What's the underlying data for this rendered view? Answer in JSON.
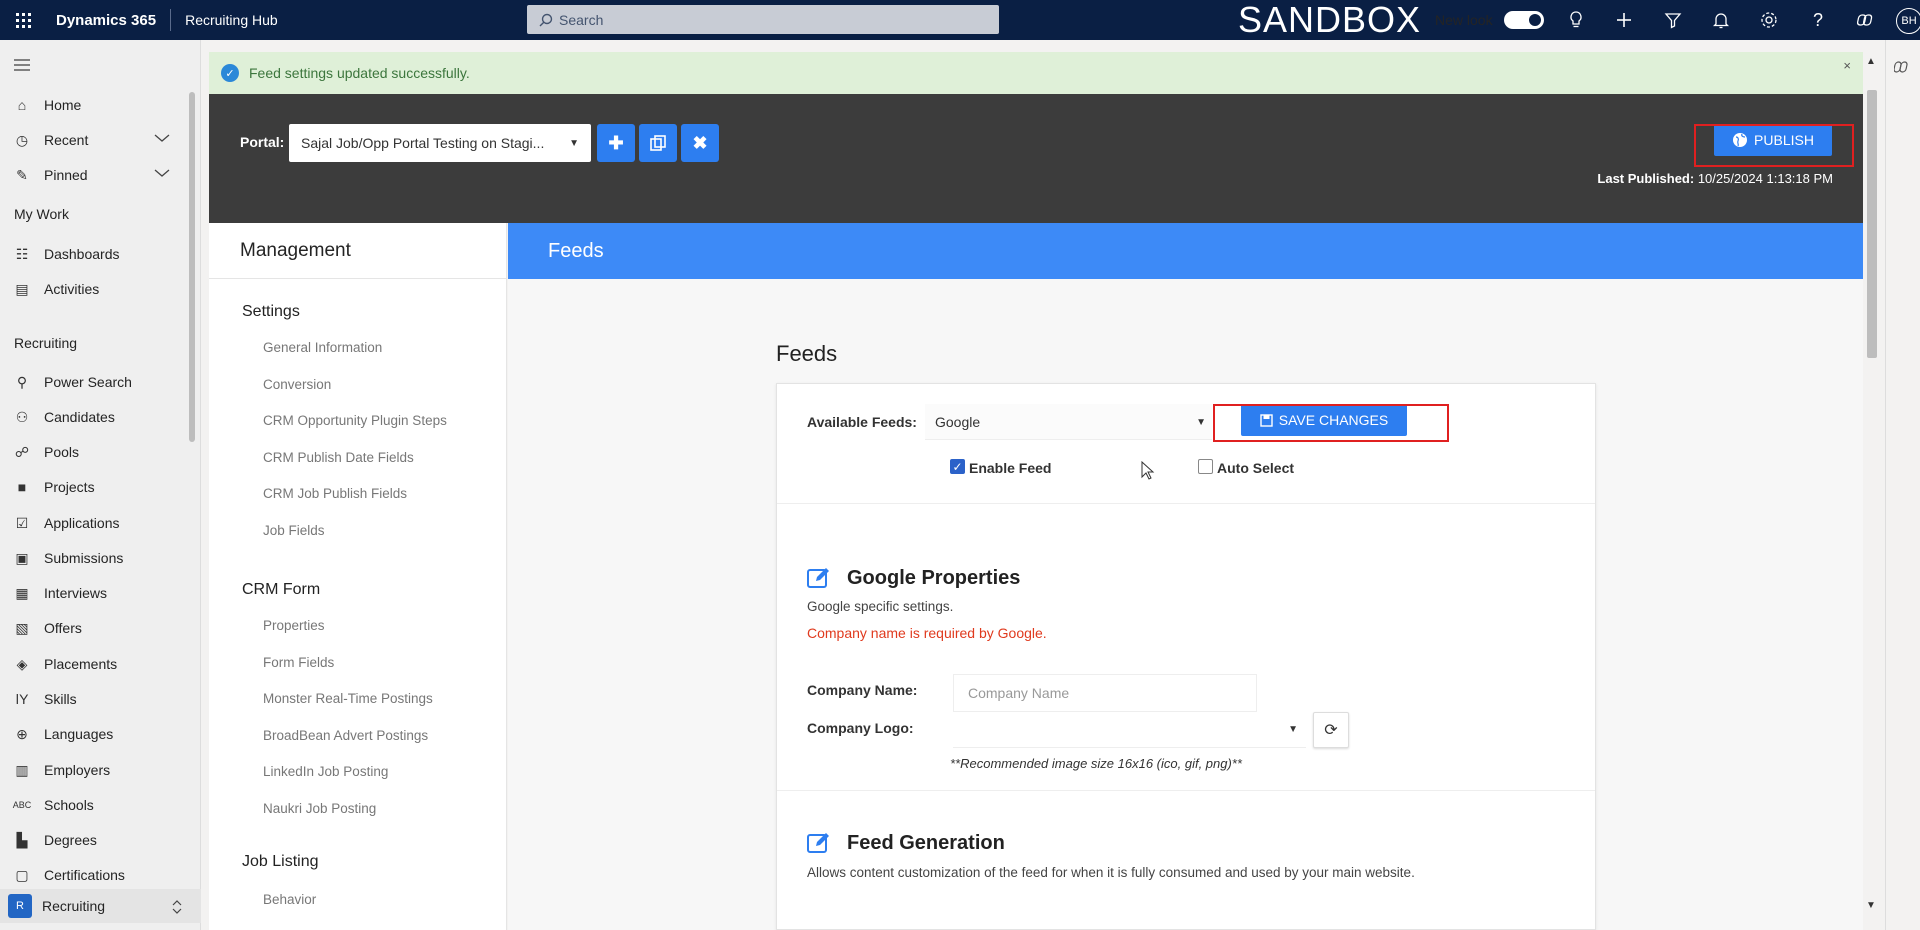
{
  "topbar": {
    "app_name": "Dynamics 365",
    "area_name": "Recruiting Hub",
    "search_placeholder": "Search",
    "environment": "SANDBOX",
    "new_look_label": "New look",
    "new_look_on": true,
    "avatar_initials": "BH",
    "icons": [
      "lightbulb-icon",
      "plus-icon",
      "filter-icon",
      "bell-icon",
      "gear-icon",
      "help-icon",
      "copilot-icon"
    ]
  },
  "nav": {
    "home": "Home",
    "recent": "Recent",
    "pinned": "Pinned",
    "my_work": "My Work",
    "dashboards": "Dashboards",
    "activities": "Activities",
    "recruiting_group": "Recruiting",
    "items": [
      "Power Search",
      "Candidates",
      "Pools",
      "Projects",
      "Applications",
      "Submissions",
      "Interviews",
      "Offers",
      "Placements",
      "Skills",
      "Languages",
      "Employers",
      "Schools",
      "Degrees",
      "Certifications"
    ],
    "area_badge": "R",
    "area_switch": "Recruiting"
  },
  "alert": {
    "message": "Feed settings updated successfully.",
    "close": "×"
  },
  "portal": {
    "label": "Portal:",
    "selected": "Sajal Job/Opp Portal Testing on Stagi...",
    "publish_label": "PUBLISH",
    "last_published_label": "Last Published:",
    "last_published_value": "10/25/2024 1:13:18 PM"
  },
  "management": {
    "title": "Management",
    "settings_title": "Settings",
    "settings_links": [
      "General Information",
      "Conversion",
      "CRM Opportunity Plugin Steps",
      "CRM Publish Date Fields",
      "CRM Job Publish Fields",
      "Job Fields"
    ],
    "crm_form_title": "CRM Form",
    "crm_form_links": [
      "Properties",
      "Form Fields",
      "Monster Real-Time Postings",
      "BroadBean Advert Postings",
      "LinkedIn Job Posting",
      "Naukri Job Posting"
    ],
    "job_listing_title": "Job Listing",
    "job_listing_links": [
      "Behavior"
    ]
  },
  "feeds": {
    "header": "Feeds",
    "title": "Feeds",
    "available_label": "Available Feeds:",
    "available_value": "Google",
    "save_label": "SAVE CHANGES",
    "enable_label": "Enable Feed",
    "enable_checked": true,
    "auto_label": "Auto Select",
    "auto_checked": false,
    "google": {
      "title": "Google Properties",
      "desc": "Google specific settings.",
      "error": "Company name is required by Google.",
      "company_name_label": "Company Name:",
      "company_name_placeholder": "Company Name",
      "company_logo_label": "Company Logo:",
      "hint": "**Recommended image size 16x16 (ico, gif, png)**"
    },
    "generation": {
      "title": "Feed Generation",
      "desc": "Allows content customization of the feed for when it is fully consumed and used by your main website."
    }
  },
  "colors": {
    "topbar": "#0a1f44",
    "accent": "#2d7ef0",
    "header_blue": "#3d8af7",
    "success_bg": "#dff0d8",
    "error": "#e03a1e",
    "highlight": "#e02020"
  }
}
